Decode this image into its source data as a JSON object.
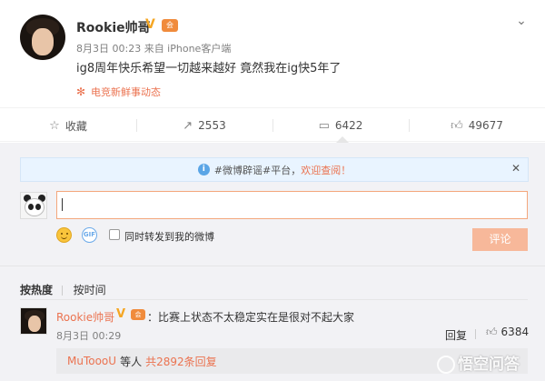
{
  "post": {
    "username": "Rookie帅哥",
    "verified_badge": "V",
    "medal_text": "会",
    "meta": "8月3日 00:23 来自 iPhone客户端",
    "text": "ig8周年快乐希望一切越来越好 竟然我在ig快5年了",
    "topic": "电竞新鲜事动态",
    "topic_icon": "flower-icon",
    "menu_icon": "chevron-down-icon"
  },
  "actions": {
    "favorite": {
      "label": "收藏",
      "icon": "star-icon"
    },
    "repost": {
      "count": "2553",
      "icon": "repost-icon"
    },
    "comment": {
      "count": "6422",
      "icon": "comment-icon"
    },
    "like": {
      "count": "49677",
      "icon": "thumbs-up-icon"
    }
  },
  "notice": {
    "prefix": "#微博辟谣#平台，",
    "welcome": "欢迎查阅！",
    "info_icon": "info-icon",
    "close_icon": "close-icon"
  },
  "composer": {
    "input_value": "",
    "emoji_icon": "smile-icon",
    "gif_label": "GIF",
    "repost_checkbox_label": "同时转发到我的微博",
    "repost_checked": false,
    "submit_label": "评论"
  },
  "sort": {
    "by_hot": "按热度",
    "by_time": "按时间",
    "active": "by_hot"
  },
  "comment": {
    "username": "Rookie帅哥",
    "verified_badge": "V",
    "medal_text": "会",
    "text": "：比赛上状态不太稳定实在是很对不起大家",
    "time": "8月3日 00:29",
    "reply_label": "回复",
    "like_count": "6384",
    "replies_user": "MuToooU",
    "replies_middle": "等人",
    "replies_count": "共2892条回复"
  },
  "watermark": {
    "text": "悟空问答"
  },
  "colors": {
    "accent": "#eb7350",
    "verified": "#f5a623",
    "notice_bg": "#e9f4ff",
    "submit_bg": "#f7b89a",
    "area_bg": "#f2f2f5"
  }
}
